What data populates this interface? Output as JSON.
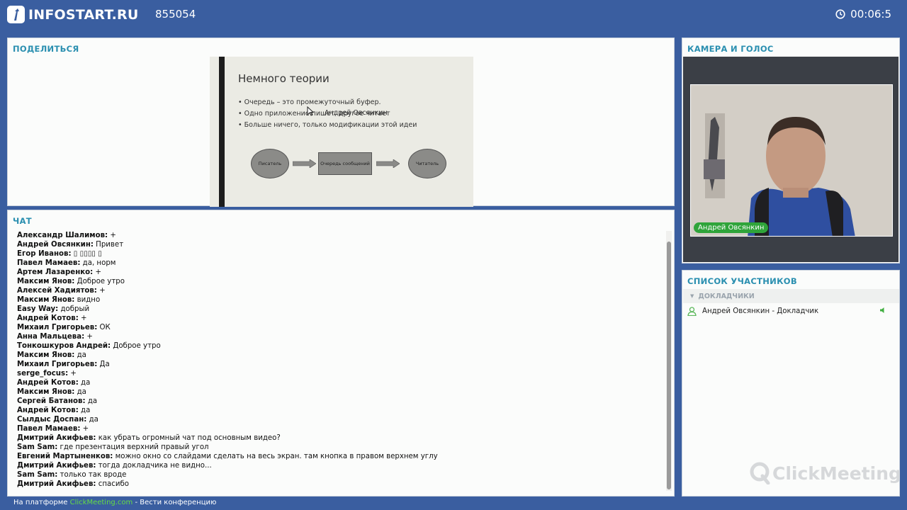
{
  "header": {
    "logo_text": "INFOSTART.RU",
    "room_id": "855054",
    "timer": "00:06:5"
  },
  "share": {
    "title": "ПОДЕЛИТЬСЯ",
    "slide": {
      "heading": "Немного теории",
      "bullets": [
        "Очередь – это промежуточный буфер.",
        "Одно приложение пишет, другое читает",
        "Больше ничего, только модификации этой идеи"
      ],
      "overlay_name": "Андрей Овсянкин",
      "flow": [
        "Писатель",
        "Очередь сообщений",
        "Читатель"
      ]
    }
  },
  "chat": {
    "title": "ЧАТ",
    "messages": [
      {
        "author": "Александр Шалимов:",
        "text": " +"
      },
      {
        "author": "Андрей Овсянкин:",
        "text": " Привет"
      },
      {
        "author": "Егор Иванов:",
        "text": " ▯ ▯▯▯▯ ▯"
      },
      {
        "author": "Павел Мамаев:",
        "text": " да, норм"
      },
      {
        "author": "Артем Лазаренко:",
        "text": " +"
      },
      {
        "author": "Максим Янов:",
        "text": " Доброе утро"
      },
      {
        "author": "Алексей Хадиятов:",
        "text": " +"
      },
      {
        "author": "Максим Янов:",
        "text": " видно"
      },
      {
        "author": "Easy Way:",
        "text": " добрый"
      },
      {
        "author": "Андрей Котов:",
        "text": " +"
      },
      {
        "author": "Михаил Григорьев:",
        "text": " ОК"
      },
      {
        "author": "Анна Мальцева:",
        "text": " +"
      },
      {
        "author": "Тонкошкуров Андрей:",
        "text": " Доброе утро"
      },
      {
        "author": "Максим Янов:",
        "text": " да"
      },
      {
        "author": "Михаил Григорьев:",
        "text": " Да"
      },
      {
        "author": "serge_focus:",
        "text": " +"
      },
      {
        "author": "Андрей Котов:",
        "text": " да"
      },
      {
        "author": "Максим Янов:",
        "text": " да"
      },
      {
        "author": "Сергей Батанов:",
        "text": " да"
      },
      {
        "author": "Андрей Котов:",
        "text": " да"
      },
      {
        "author": "Сылдыс Доспан:",
        "text": " да"
      },
      {
        "author": "Павел Мамаев:",
        "text": " +"
      },
      {
        "author": "Дмитрий Акифьев:",
        "text": " как убрать огромный чат под основным видео?"
      },
      {
        "author": "Sam Sam:",
        "text": " где презентация верхний правый угол"
      },
      {
        "author": "Евгений Мартыненков:",
        "text": " можно окно со слайдами сделать на весь экран. там кнопка в правом верхнем углу"
      },
      {
        "author": "Дмитрий Акифьев:",
        "text": " тогда докладчика не видно..."
      },
      {
        "author": "Sam Sam:",
        "text": " только так вроде"
      },
      {
        "author": "Дмитрий Акифьев:",
        "text": " спасибо"
      }
    ]
  },
  "camera": {
    "title": "КАМЕРА И ГОЛОС",
    "speaker_name": "Андрей Овсянкин"
  },
  "participants": {
    "title": "СПИСОК УЧАСТНИКОВ",
    "group_label": "ДОКЛАДЧИКИ",
    "items": [
      {
        "name": "Андрей Овсянкин  - Докладчик"
      }
    ],
    "brand": "ClickMeeting"
  },
  "footer": {
    "prefix": "На платформе ",
    "link": "ClickMeeting.com",
    "suffix": " - Вести конференцию"
  },
  "colors": {
    "background": "#3a5ea0",
    "panel_title": "#2a8fb0",
    "speaker_badge": "#2fa43a",
    "footer_link": "#66dd44"
  }
}
